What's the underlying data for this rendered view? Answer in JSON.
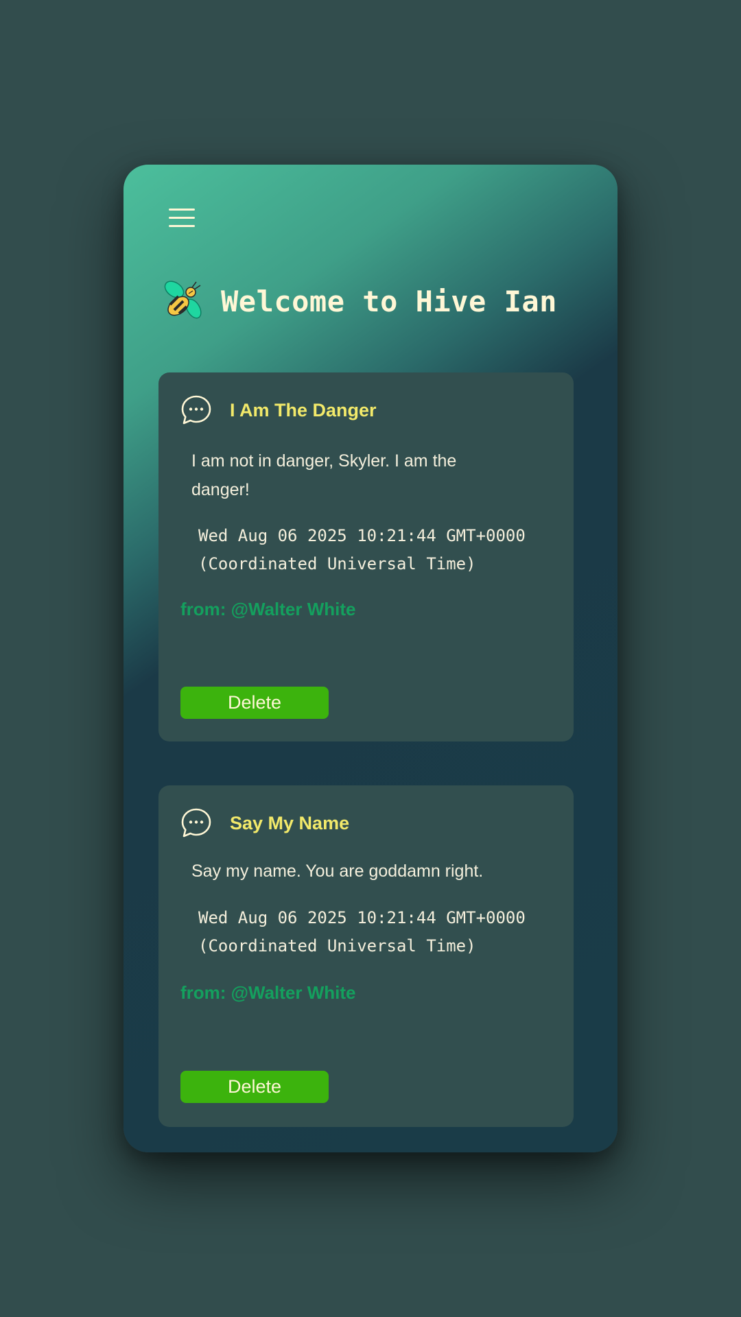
{
  "header": {
    "title": "Welcome to Hive Ian"
  },
  "posts": [
    {
      "title": "I Am The Danger",
      "body": "I am not in danger, Skyler. I am the danger!",
      "date": "Wed Aug 06 2025 10:21:44 GMT+0000 (Coordinated Universal Time)",
      "from": "from: @Walter White",
      "delete_label": "Delete"
    },
    {
      "title": "Say My Name",
      "body": "Say my name. You are goddamn right.",
      "date": "Wed Aug 06 2025 10:21:44 GMT+0000 (Coordinated Universal Time)",
      "from": "from: @Walter White",
      "delete_label": "Delete"
    }
  ],
  "colors": {
    "background": "#324d4d",
    "card": "#324f4f",
    "title_accent": "#f2e96a",
    "author": "#14a05e",
    "delete_button": "#3cb30d",
    "text": "#f4efdc"
  },
  "icons": {
    "menu": "hamburger-menu-icon",
    "logo": "bee-logo-icon",
    "post": "chat-bubble-icon"
  }
}
